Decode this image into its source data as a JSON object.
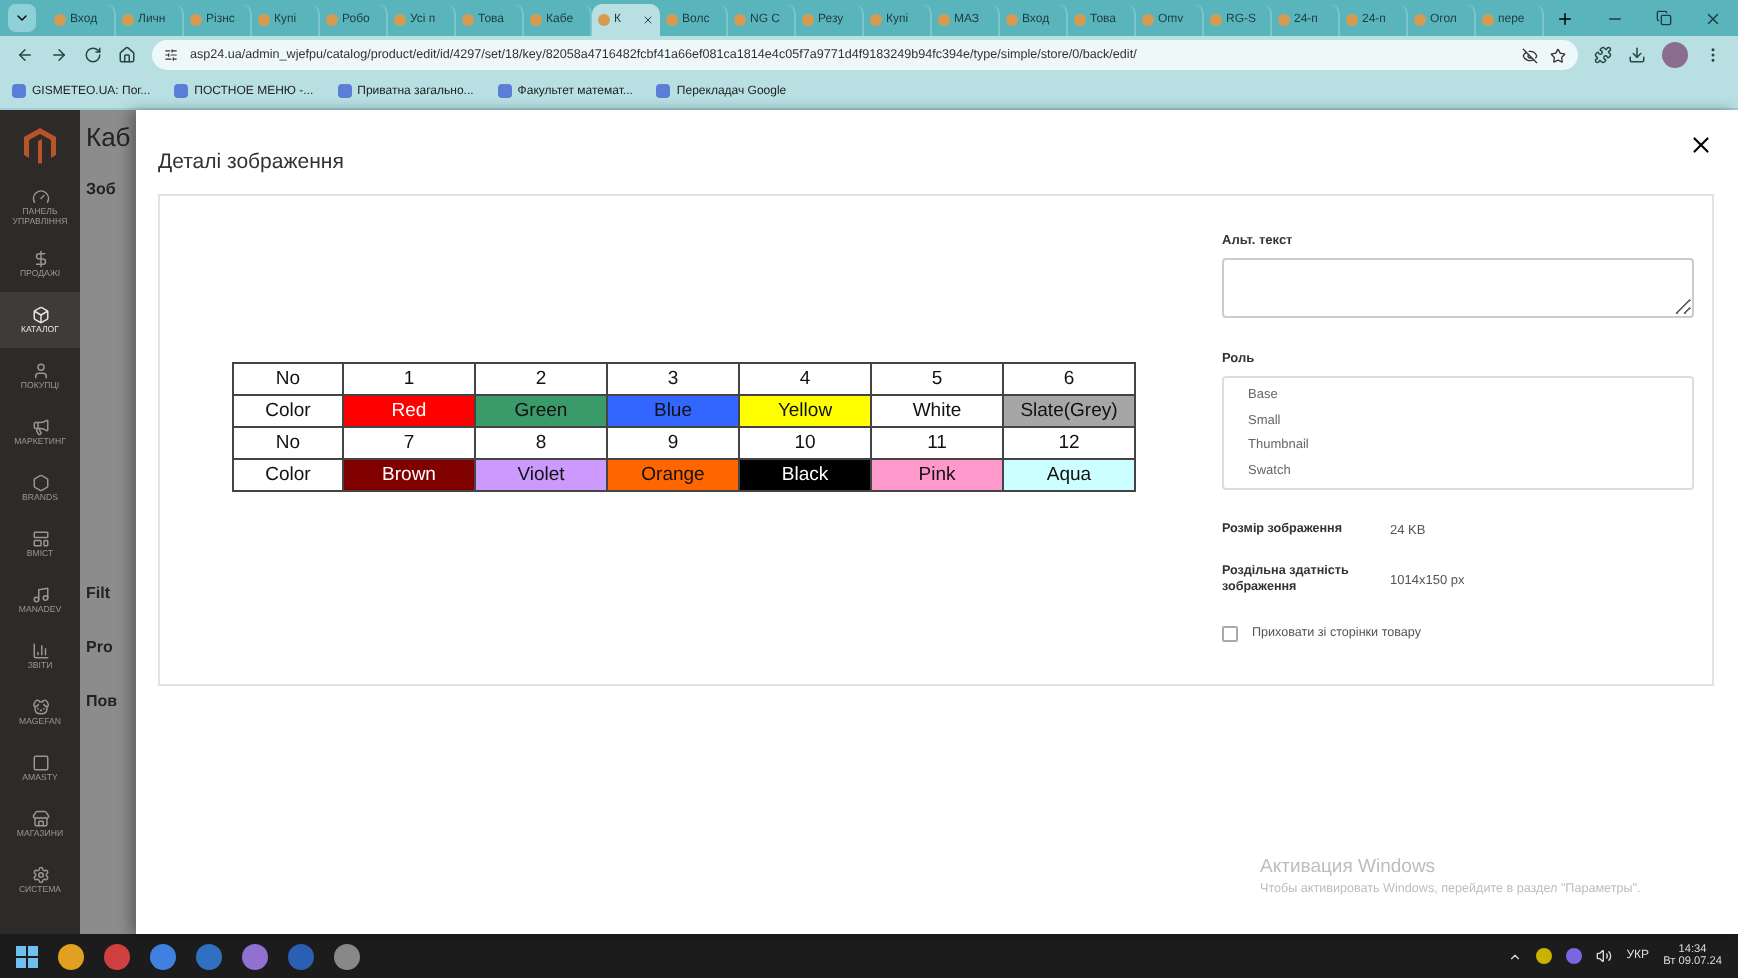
{
  "browser": {
    "tabs": [
      {
        "label": "Вход",
        "selected": false
      },
      {
        "label": "Личн",
        "selected": false
      },
      {
        "label": "Різнс",
        "selected": false
      },
      {
        "label": "Купі",
        "selected": false
      },
      {
        "label": "Робо",
        "selected": false
      },
      {
        "label": "Усі п",
        "selected": false
      },
      {
        "label": "Това",
        "selected": false
      },
      {
        "label": "Кабе",
        "selected": false
      },
      {
        "label": "К",
        "selected": true
      },
      {
        "label": "Волс",
        "selected": false
      },
      {
        "label": "NG С",
        "selected": false
      },
      {
        "label": "Резу",
        "selected": false
      },
      {
        "label": "Купі",
        "selected": false
      },
      {
        "label": "МАЗ",
        "selected": false
      },
      {
        "label": "Вход",
        "selected": false
      },
      {
        "label": "Това",
        "selected": false
      },
      {
        "label": "Omv",
        "selected": false
      },
      {
        "label": "RG-S",
        "selected": false
      },
      {
        "label": "24-п",
        "selected": false
      },
      {
        "label": "24-п",
        "selected": false
      },
      {
        "label": "Огол",
        "selected": false
      },
      {
        "label": "пере",
        "selected": false
      }
    ],
    "address": "asp24.ua/admin_wjefpu/catalog/product/edit/id/4297/set/18/key/82058a4716482fcbf41a66ef081ca1814e4c05f7a9771d4f9183249b94fc394e/type/simple/store/0/back/edit/",
    "bookmarks": [
      "GISMETEO.UA: Пог...",
      "ПОСТНОЕ МЕНЮ -...",
      "Приватна загально...",
      "Факультет математ...",
      "Перекладач Google"
    ]
  },
  "sidebar": {
    "items": [
      {
        "label": "ПАНЕЛЬ УПРАВЛІННЯ",
        "selected": false
      },
      {
        "label": "ПРОДАЖІ",
        "selected": false
      },
      {
        "label": "КАТАЛОГ",
        "selected": true
      },
      {
        "label": "ПОКУПЦІ",
        "selected": false
      },
      {
        "label": "МАРКЕТИНГ",
        "selected": false
      },
      {
        "label": "BRANDS",
        "selected": false
      },
      {
        "label": "ВМІСТ",
        "selected": false
      },
      {
        "label": "MANADEV",
        "selected": false
      },
      {
        "label": "ЗВІТИ",
        "selected": false
      },
      {
        "label": "MAGEFAN",
        "selected": false
      },
      {
        "label": "AMASTY",
        "selected": false
      },
      {
        "label": "МАГАЗИНИ",
        "selected": false
      },
      {
        "label": "СИСТЕМА",
        "selected": false
      }
    ]
  },
  "page_behind": {
    "title": "Каб",
    "sections": [
      "Зоб",
      "Filt",
      "Pro",
      "Пов"
    ]
  },
  "modal": {
    "title": "Деталі зображення",
    "image_table": {
      "rows": [
        {
          "header": "No",
          "cells": [
            {
              "text": "1",
              "color": "#ffffff"
            },
            {
              "text": "2",
              "color": "#ffffff"
            },
            {
              "text": "3",
              "color": "#ffffff"
            },
            {
              "text": "4",
              "color": "#ffffff"
            },
            {
              "text": "5",
              "color": "#ffffff"
            },
            {
              "text": "6",
              "color": "#ffffff"
            }
          ]
        },
        {
          "header": "Color",
          "cells": [
            {
              "text": "Red",
              "color": "#ff0000"
            },
            {
              "text": "Green",
              "color": "#3a9a6a"
            },
            {
              "text": "Blue",
              "color": "#3366ff"
            },
            {
              "text": "Yellow",
              "color": "#ffff00"
            },
            {
              "text": "White",
              "color": "#ffffff"
            },
            {
              "text": "Slate(Grey)",
              "color": "#a6a6a6"
            }
          ]
        },
        {
          "header": "No",
          "cells": [
            {
              "text": "7",
              "color": "#ffffff"
            },
            {
              "text": "8",
              "color": "#ffffff"
            },
            {
              "text": "9",
              "color": "#ffffff"
            },
            {
              "text": "10",
              "color": "#ffffff"
            },
            {
              "text": "11",
              "color": "#ffffff"
            },
            {
              "text": "12",
              "color": "#ffffff"
            }
          ]
        },
        {
          "header": "Color",
          "cells": [
            {
              "text": "Brown",
              "color": "#800000"
            },
            {
              "text": "Violet",
              "color": "#cc99ff"
            },
            {
              "text": "Orange",
              "color": "#ff6600"
            },
            {
              "text": "Black",
              "color": "#000000"
            },
            {
              "text": "Pink",
              "color": "#ff99cc"
            },
            {
              "text": "Aqua",
              "color": "#ccffff"
            }
          ]
        }
      ]
    },
    "alt_text": {
      "label": "Альт. текст"
    },
    "role": {
      "label": "Роль",
      "options": [
        "Base",
        "Small",
        "Thumbnail",
        "Swatch"
      ]
    },
    "info": [
      {
        "label": "Розмір зображення",
        "value": "24 KB"
      },
      {
        "label": "Роздільна здатність зображення",
        "value": "1014x150 px"
      }
    ],
    "hide_checkbox": {
      "label": "Приховати зі сторінки товару",
      "checked": false
    }
  },
  "windows_notice": {
    "title": "Активация Windows",
    "text": "Чтобы активировать Windows, перейдите в раздел \"Параметры\"."
  },
  "taskbar": {
    "language": "УКР",
    "time": "14:34",
    "date": "Вт 09.07.24"
  }
}
